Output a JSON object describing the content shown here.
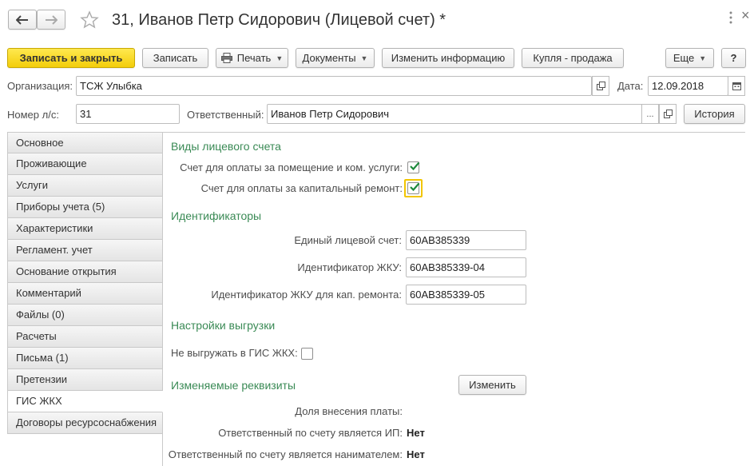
{
  "title": "31, Иванов Петр Сидорович (Лицевой счет) *",
  "nav": {
    "back_icon": "arrow-left-icon",
    "forward_icon": "arrow-right-icon",
    "favorite_icon": "star-icon"
  },
  "window": {
    "more_icon": "more-vertical-icon",
    "close_label": "×"
  },
  "toolbar": {
    "save_close": "Записать и закрыть",
    "save": "Записать",
    "print": "Печать",
    "documents": "Документы",
    "change_info": "Изменить информацию",
    "buy_sell": "Купля - продажа",
    "more": "Еще",
    "help": "?"
  },
  "header": {
    "org_label": "Организация:",
    "org_value": "ТСЖ Улыбка",
    "date_label": "Дата:",
    "date_value": "12.09.2018",
    "account_label": "Номер л/с:",
    "account_value": "31",
    "responsible_label": "Ответственный:",
    "responsible_value": "Иванов Петр Сидорович",
    "history_button": "История",
    "select_button": "...",
    "open_icon": "open-link-icon",
    "calendar_icon": "calendar-icon"
  },
  "tabs": [
    {
      "label": "Основное"
    },
    {
      "label": "Проживающие"
    },
    {
      "label": "Услуги"
    },
    {
      "label": "Приборы учета (5)"
    },
    {
      "label": "Характеристики"
    },
    {
      "label": "Регламент. учет"
    },
    {
      "label": "Основание открытия"
    },
    {
      "label": "Комментарий"
    },
    {
      "label": "Файлы (0)"
    },
    {
      "label": "Расчеты"
    },
    {
      "label": "Письма (1)"
    },
    {
      "label": "Претензии"
    },
    {
      "label": "ГИС ЖКХ"
    },
    {
      "label": "Договоры ресурсоснабжения"
    }
  ],
  "active_tab": "ГИС ЖКХ",
  "account_types": {
    "title": "Виды лицевого счета",
    "premises_label": "Счет для оплаты за помещение и ком. услуги:",
    "premises_checked": true,
    "capital_label": "Счет для оплаты за капитальный ремонт:",
    "capital_checked": true
  },
  "identifiers": {
    "title": "Идентификаторы",
    "unified_label": "Единый лицевой счет:",
    "unified_value": "60АВ385339",
    "zhku_label": "Идентификатор ЖКУ:",
    "zhku_value": "60АВ385339-04",
    "capital_label": "Идентификатор ЖКУ для кап. ремонта:",
    "capital_value": "60АВ385339-05"
  },
  "export": {
    "title": "Настройки выгрузки",
    "no_export_label": "Не выгружать в ГИС ЖКХ:",
    "no_export_checked": false
  },
  "variable": {
    "title": "Изменяемые реквизиты",
    "change_button": "Изменить",
    "share_label": "Доля внесения платы:",
    "share_value": "",
    "ip_label": "Ответственный по счету является ИП:",
    "ip_value": "Нет",
    "tenant_label": "Ответственный по счету является нанимателем:",
    "tenant_value": "Нет"
  },
  "colors": {
    "accent_yellow": "#f5d31a",
    "section_green": "#3a8a55",
    "check_green": "#1e8a3c",
    "focus_yellow": "#f2c500"
  }
}
